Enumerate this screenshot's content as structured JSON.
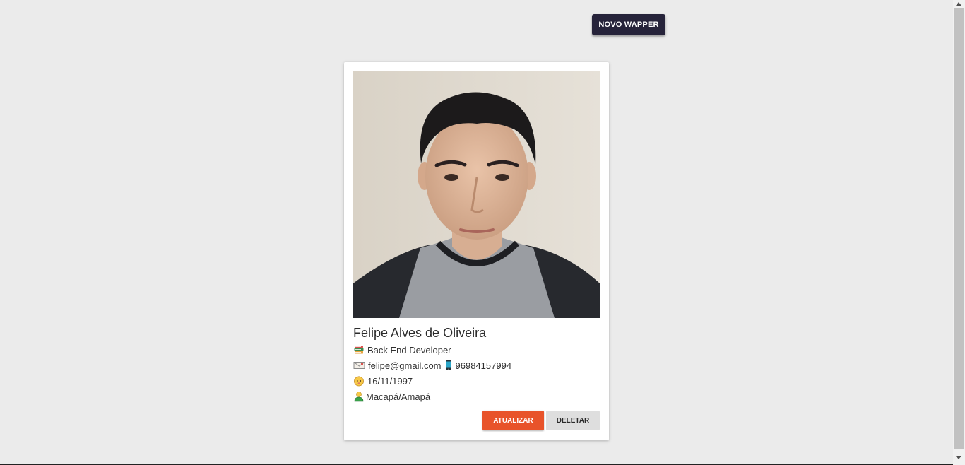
{
  "header": {
    "new_button_label": "NOVO WAPPER"
  },
  "card": {
    "name": "Felipe Alves de Oliveira",
    "role": "Back End Developer",
    "email": "felipe@gmail.com",
    "phone": "96984157994",
    "birthdate": "16/11/1997",
    "location": "Macapá/Amapá",
    "update_label": "ATUALIZAR",
    "delete_label": "DELETAR"
  },
  "icons": {
    "role": "books-icon",
    "email": "envelope-icon",
    "phone": "mobile-phone-icon",
    "birthdate": "baby-face-icon",
    "location": "map-pin-person-icon"
  },
  "colors": {
    "primary_dark": "#26233a",
    "accent_orange": "#e8532a",
    "background": "#ebebeb"
  }
}
